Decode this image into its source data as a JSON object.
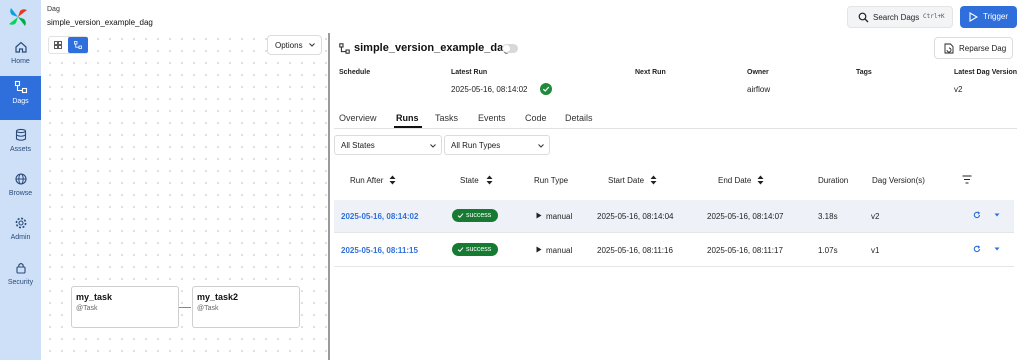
{
  "header": {
    "breadcrumb": "Dag",
    "dag_id": "simple_version_example_dag"
  },
  "search": {
    "label": "Search Dags",
    "shortcut": "Ctrl+K"
  },
  "trigger": {
    "label": "Trigger"
  },
  "sidebar": {
    "items": [
      {
        "label": "Home",
        "icon": "home-icon"
      },
      {
        "label": "Dags",
        "icon": "dags-icon",
        "active": true
      },
      {
        "label": "Assets",
        "icon": "assets-icon"
      },
      {
        "label": "Browse",
        "icon": "globe-icon"
      },
      {
        "label": "Admin",
        "icon": "gear-icon"
      },
      {
        "label": "Security",
        "icon": "lock-icon"
      }
    ]
  },
  "graph": {
    "options_label": "Options",
    "tasks": [
      {
        "name": "my_task",
        "type": "@Task"
      },
      {
        "name": "my_task2",
        "type": "@Task"
      }
    ]
  },
  "dag": {
    "title": "simple_version_example_dag",
    "reparse_label": "Reparse Dag",
    "meta_headers": {
      "schedule": "Schedule",
      "latest_run": "Latest Run",
      "next_run": "Next Run",
      "owner": "Owner",
      "tags": "Tags",
      "latest_version": "Latest Dag Version"
    },
    "meta_values": {
      "latest_run": "2025-05-16, 08:14:02",
      "owner": "airflow",
      "latest_version": "v2"
    }
  },
  "tabs": [
    "Overview",
    "Runs",
    "Tasks",
    "Events",
    "Code",
    "Details"
  ],
  "active_tab": "Runs",
  "filters": {
    "state": "All States",
    "run_type": "All Run Types"
  },
  "runs_table": {
    "columns": [
      "Run After",
      "State",
      "Run Type",
      "Start Date",
      "End Date",
      "Duration",
      "Dag Version(s)"
    ],
    "rows": [
      {
        "run_after": "2025-05-16, 08:14:02",
        "state": "success",
        "run_type": "manual",
        "start_date": "2025-05-16, 08:14:04",
        "end_date": "2025-05-16, 08:14:07",
        "duration": "3.18s",
        "version": "v2"
      },
      {
        "run_after": "2025-05-16, 08:11:15",
        "state": "success",
        "run_type": "manual",
        "start_date": "2025-05-16, 08:11:16",
        "end_date": "2025-05-16, 08:11:17",
        "duration": "1.07s",
        "version": "v1"
      }
    ]
  },
  "colors": {
    "accent": "#2f6fdc",
    "sidebar": "#cde0f7",
    "success": "#167a32"
  }
}
